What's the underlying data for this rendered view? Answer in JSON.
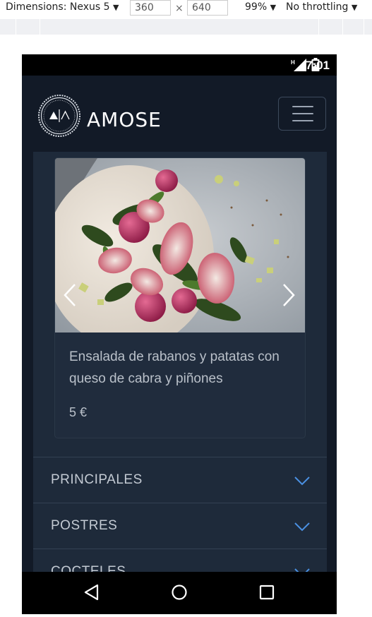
{
  "devtools": {
    "device_label": "Dimensions: Nexus 5",
    "device_caret": "▼",
    "width_value": "360",
    "times": "×",
    "height_value": "640",
    "zoom_label": "99%",
    "zoom_caret": "▼",
    "throttle_label": "No throttling",
    "throttle_caret": "▼"
  },
  "statusbar": {
    "network_letter": "H",
    "time": "7:01"
  },
  "app": {
    "brand": "AMOSE",
    "logo_letters": "A|A"
  },
  "featured": {
    "dish_name": "Ensalada de rabanos y patatas con queso de cabra y piñones",
    "price": "5 €"
  },
  "menu_sections": [
    {
      "label": "PRINCIPALES"
    },
    {
      "label": "POSTRES"
    },
    {
      "label": "COCTELES"
    }
  ],
  "colors": {
    "background": "#121a27",
    "panel": "#1e2a3a",
    "card": "#202c3d",
    "accent_chevron": "#4a90e2",
    "text": "#b9c0c9"
  },
  "icons": {
    "menu": "hamburger-icon",
    "prev": "chevron-left-icon",
    "next": "chevron-right-icon",
    "expand": "chevron-down-icon",
    "back": "back-triangle-icon",
    "home": "home-circle-icon",
    "recents": "recents-square-icon"
  }
}
